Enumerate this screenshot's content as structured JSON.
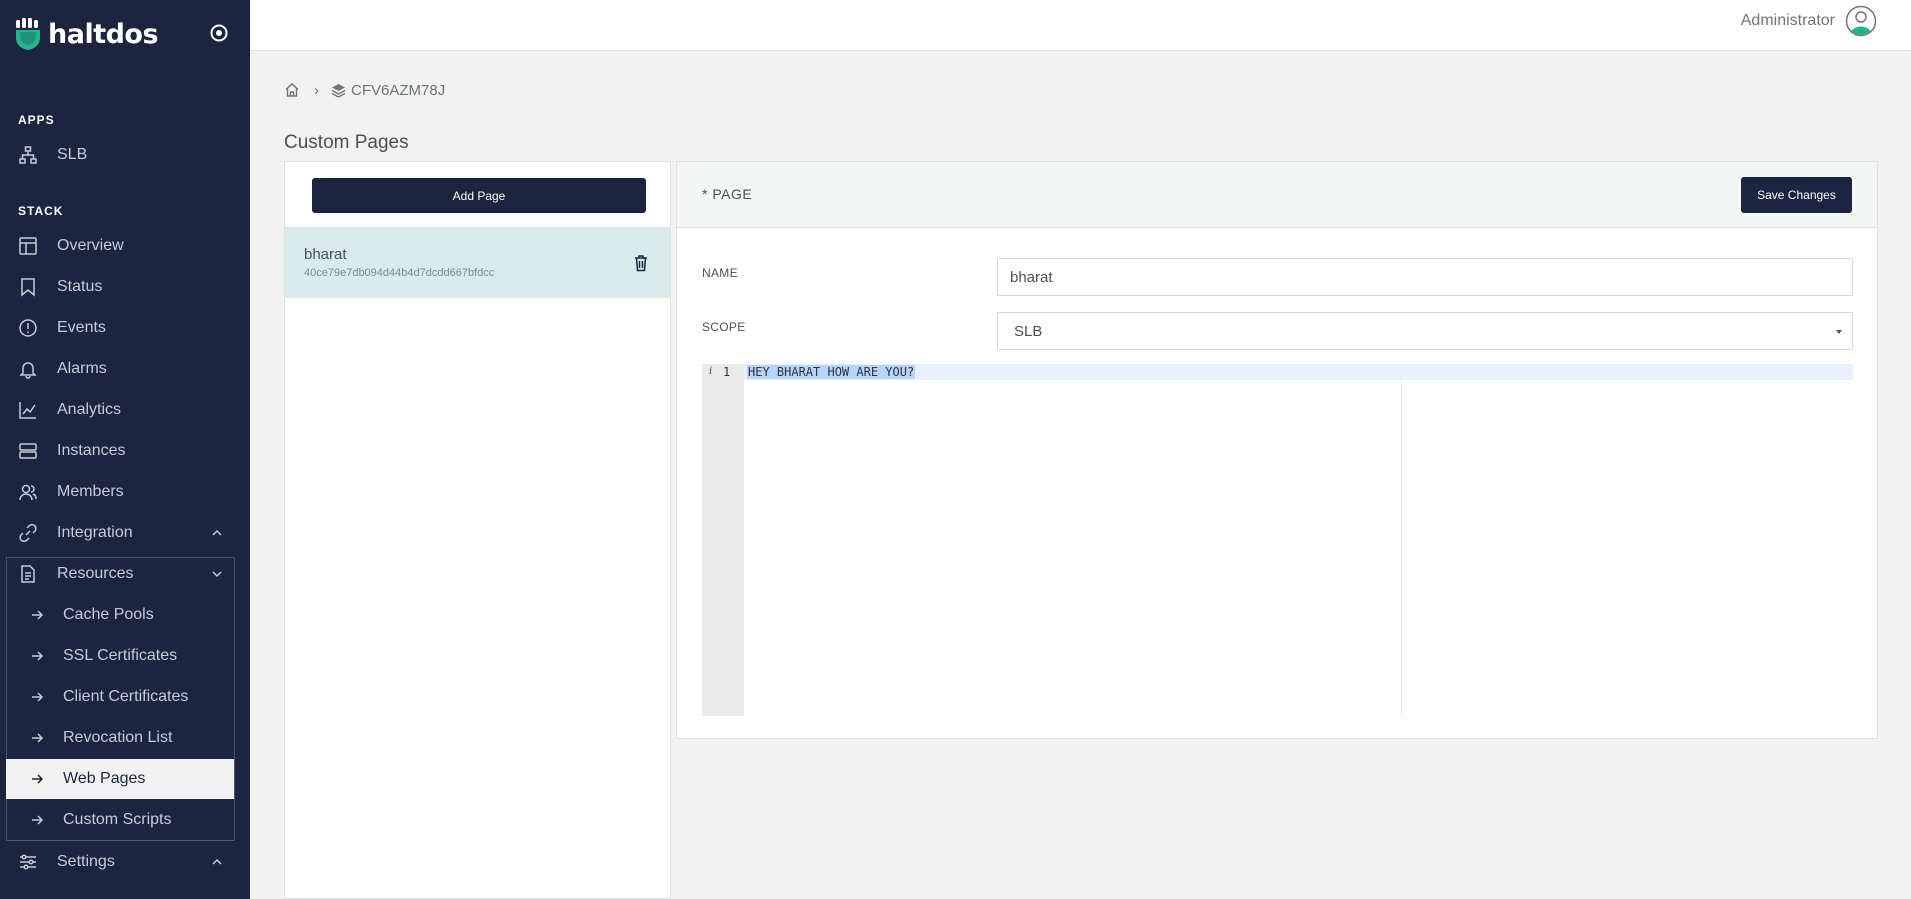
{
  "brand": {
    "name": "haltdos"
  },
  "sidebar": {
    "apps_label": "APPS",
    "stack_label": "STACK",
    "apps": [
      {
        "label": "SLB",
        "icon": "sitemap-icon"
      }
    ],
    "stack": [
      {
        "label": "Overview",
        "icon": "layout-icon"
      },
      {
        "label": "Status",
        "icon": "bookmark-icon"
      },
      {
        "label": "Events",
        "icon": "alert-circle-icon"
      },
      {
        "label": "Alarms",
        "icon": "bell-icon"
      },
      {
        "label": "Analytics",
        "icon": "chart-line-icon"
      },
      {
        "label": "Instances",
        "icon": "server-icon"
      },
      {
        "label": "Members",
        "icon": "users-icon"
      },
      {
        "label": "Integration",
        "icon": "link-icon"
      },
      {
        "label": "Resources",
        "icon": "file-icon"
      }
    ],
    "resources": [
      {
        "label": "Cache Pools"
      },
      {
        "label": "SSL Certificates"
      },
      {
        "label": "Client Certificates"
      },
      {
        "label": "Revocation List"
      },
      {
        "label": "Web Pages",
        "active": true
      },
      {
        "label": "Custom Scripts"
      }
    ],
    "settings": {
      "label": "Settings",
      "icon": "sliders-icon"
    }
  },
  "topbar": {
    "user": "Administrator"
  },
  "breadcrumb": {
    "sep": "›",
    "stack_id": "CFV6AZM78J"
  },
  "page": {
    "title": "Custom Pages"
  },
  "list": {
    "add_label": "Add Page",
    "items": [
      {
        "name": "bharat",
        "id": "40ce79e7db094d44b4d7dcdd667bfdcc"
      }
    ]
  },
  "editor": {
    "title": "* PAGE",
    "save_label": "Save Changes",
    "name_label": "NAME",
    "name_value": "bharat",
    "scope_label": "SCOPE",
    "scope_value": "SLB",
    "gutter_info": "i",
    "line_number": "1",
    "code": "HEY BHARAT HOW ARE YOU?"
  },
  "colors": {
    "sidebar_bg": "#1b2540",
    "accent_selected_row": "#d9ebea",
    "brand_green": "#23b68a"
  }
}
